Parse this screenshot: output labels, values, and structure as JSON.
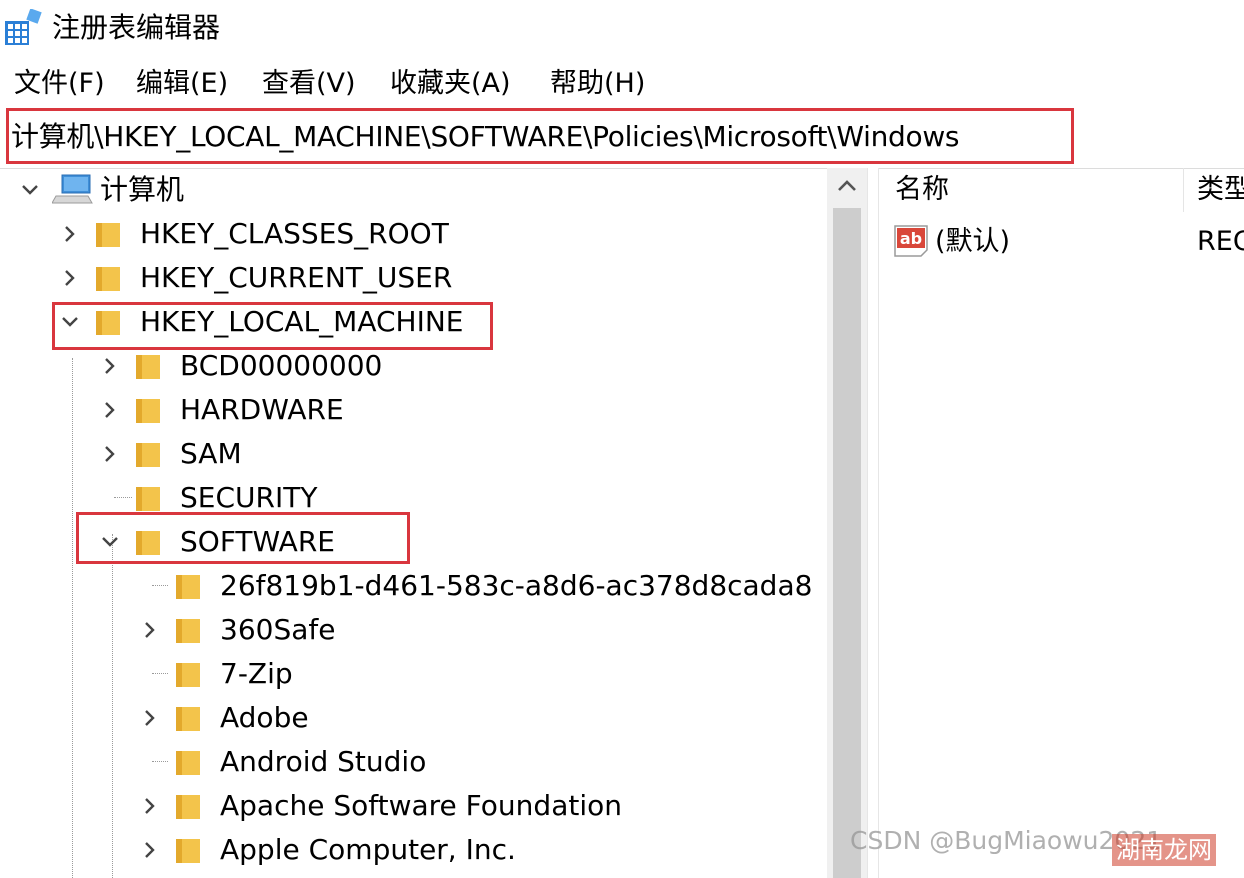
{
  "window": {
    "title": "注册表编辑器"
  },
  "menu": [
    "文件(F)",
    "编辑(E)",
    "查看(V)",
    "收藏夹(A)",
    "帮助(H)"
  ],
  "address": {
    "path": "计算机\\HKEY_LOCAL_MACHINE\\SOFTWARE\\Policies\\Microsoft\\Windows"
  },
  "tree": {
    "root": "计算机",
    "hives": [
      "HKEY_CLASSES_ROOT",
      "HKEY_CURRENT_USER",
      "HKEY_LOCAL_MACHINE"
    ],
    "hklm_children": [
      "BCD00000000",
      "HARDWARE",
      "SAM",
      "SECURITY",
      "SOFTWARE"
    ],
    "software_children": [
      "26f819b1-d461-583c-a8d6-ac378d8cada8",
      "360Safe",
      "7-Zip",
      "Adobe",
      "Android Studio",
      "Apache Software Foundation",
      "Apple Computer, Inc."
    ]
  },
  "list": {
    "columns": {
      "name": "名称",
      "type": "类型"
    },
    "rows": [
      {
        "name": "(默认)",
        "type": "REG_SZ",
        "icon": "string-value-icon"
      }
    ]
  },
  "watermarks": {
    "csdn": "CSDN @BugMiaowu2021",
    "site": "湖南龙网"
  },
  "colors": {
    "highlight": "#d9363e",
    "folder": "#f3c44b",
    "scrollbar_thumb": "#cdcdcd"
  }
}
